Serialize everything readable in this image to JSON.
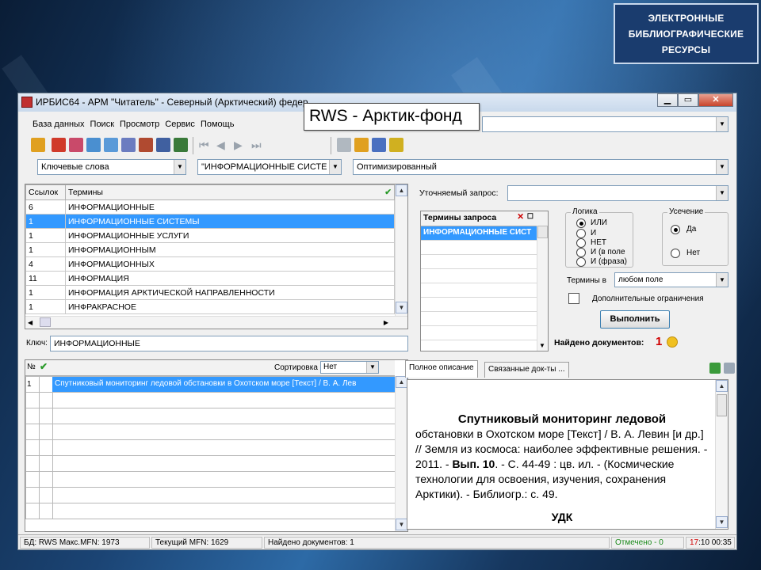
{
  "slide_title": {
    "lines": [
      "ЭЛЕКТРОННЫЕ",
      "БИБЛИОГРАФИЧЕСКИЕ",
      "РЕСУРСЫ"
    ]
  },
  "window": {
    "title": "ИРБИС64 - АРМ \"Читатель\" - Северный (Арктический) федер",
    "banner": "RWS - Арктик-фонд"
  },
  "menu": [
    "База данных",
    "Поиск",
    "Просмотр",
    "Сервис",
    "Помощь"
  ],
  "filters": {
    "search_type": "Ключевые слова",
    "term_prefix": "\"ИНФОРМАЦИОННЫЕ СИСТЕ",
    "mode": "Оптимизированный"
  },
  "terms_table": {
    "headers": [
      "Ссылок",
      "Термины"
    ],
    "rows": [
      {
        "count": "6",
        "term": "ИНФОРМАЦИОННЫЕ"
      },
      {
        "count": "1",
        "term": "ИНФОРМАЦИОННЫЕ СИСТЕМЫ"
      },
      {
        "count": "1",
        "term": "ИНФОРМАЦИОННЫЕ УСЛУГИ"
      },
      {
        "count": "1",
        "term": "ИНФОРМАЦИОННЫМ"
      },
      {
        "count": "4",
        "term": "ИНФОРМАЦИОННЫХ"
      },
      {
        "count": "11",
        "term": "ИНФОРМАЦИЯ"
      },
      {
        "count": "1",
        "term": "ИНФОРМАЦИЯ АРКТИЧЕСКОЙ НАПРАВЛЕННОСТИ"
      },
      {
        "count": "1",
        "term": "ИНФРАКРАСНОЕ"
      }
    ]
  },
  "key": {
    "label": "Ключ:",
    "value": "ИНФОРМАЦИОННЫЕ"
  },
  "query": {
    "refine_label": "Уточняемый запрос:",
    "terms_header": "Термины запроса",
    "terms": [
      "ИНФОРМАЦИОННЫЕ СИСТ"
    ],
    "logic_caption": "Логика",
    "logic_options": [
      "ИЛИ",
      "И",
      "НЕТ",
      "И (в поле",
      "И (фраза)"
    ],
    "truncation_caption": "Усечение",
    "truncation_options": [
      "Да",
      "Нет"
    ],
    "terms_in_label": "Термины в",
    "terms_in_value": "любом поле",
    "extra_label": "Дополнительные ограничения",
    "run_button": "Выполнить",
    "found_label": "Найдено документов:",
    "found_count": "1"
  },
  "results": {
    "col_no": "№",
    "sort_label": "Сортировка",
    "sort_value": "Нет",
    "rows": [
      {
        "no": "1",
        "text": "Спутниковый мониторинг ледовой обстановки в Охотском море [Текст] / В. А. Лев"
      }
    ]
  },
  "tabs": [
    "Полное описание",
    "Связанные док-ты ..."
  ],
  "description": {
    "title": "Спутниковый мониторинг ледовой",
    "body_1": "обстановки в Охотском море [Текст] / В. А. Левин [и др.] // Земля из космоса: наиболее эффективные решения. - 2011. -",
    "body_bold": "Вып. 10",
    "body_2": ". - С. 44-49 : цв. ил. - (Космические технологии для освоения, изучения, сохранения Арктики). - Библиогр.: с. 49.",
    "udk": "УДК"
  },
  "status": {
    "db": "БД: RWS Макс.MFN: 1973",
    "current": "Текущий MFN: 1629",
    "found": "Найдено документов: 1",
    "marked": "Отмечено - 0",
    "time_red": "17",
    "time_rest": ":10  00:35"
  }
}
